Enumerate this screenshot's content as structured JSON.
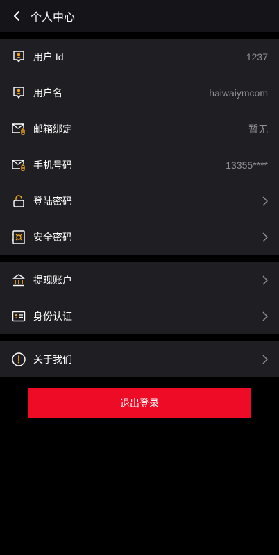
{
  "header": {
    "title": "个人中心",
    "back_icon": "chevron-left-icon"
  },
  "account_group": [
    {
      "name": "user-id",
      "label": "用户 Id",
      "value": "1237",
      "icon": "user-badge-icon"
    },
    {
      "name": "username",
      "label": "用户名",
      "value": "haiwaiymcom",
      "icon": "user-badge-icon"
    },
    {
      "name": "email-binding",
      "label": "邮箱绑定",
      "value": "暂无",
      "icon": "mail-link-icon"
    },
    {
      "name": "phone-number",
      "label": "手机号码",
      "value": "13355****",
      "icon": "mail-link-icon"
    },
    {
      "name": "login-password",
      "label": "登陆密码",
      "value": "",
      "icon": "unlock-icon"
    },
    {
      "name": "security-password",
      "label": "安全密码",
      "value": "",
      "icon": "safe-icon"
    }
  ],
  "finance_group": [
    {
      "name": "withdraw-account",
      "label": "提现账户",
      "icon": "bank-icon"
    },
    {
      "name": "identity-verification",
      "label": "身份认证",
      "icon": "id-card-icon"
    }
  ],
  "about_group": [
    {
      "name": "about-us",
      "label": "关于我们",
      "icon": "info-circle-icon"
    }
  ],
  "logout": {
    "label": "退出登录"
  },
  "colors": {
    "accent": "#f5a623",
    "logout": "#ee0b26",
    "panel": "#1f1e22",
    "header": "#151419"
  }
}
